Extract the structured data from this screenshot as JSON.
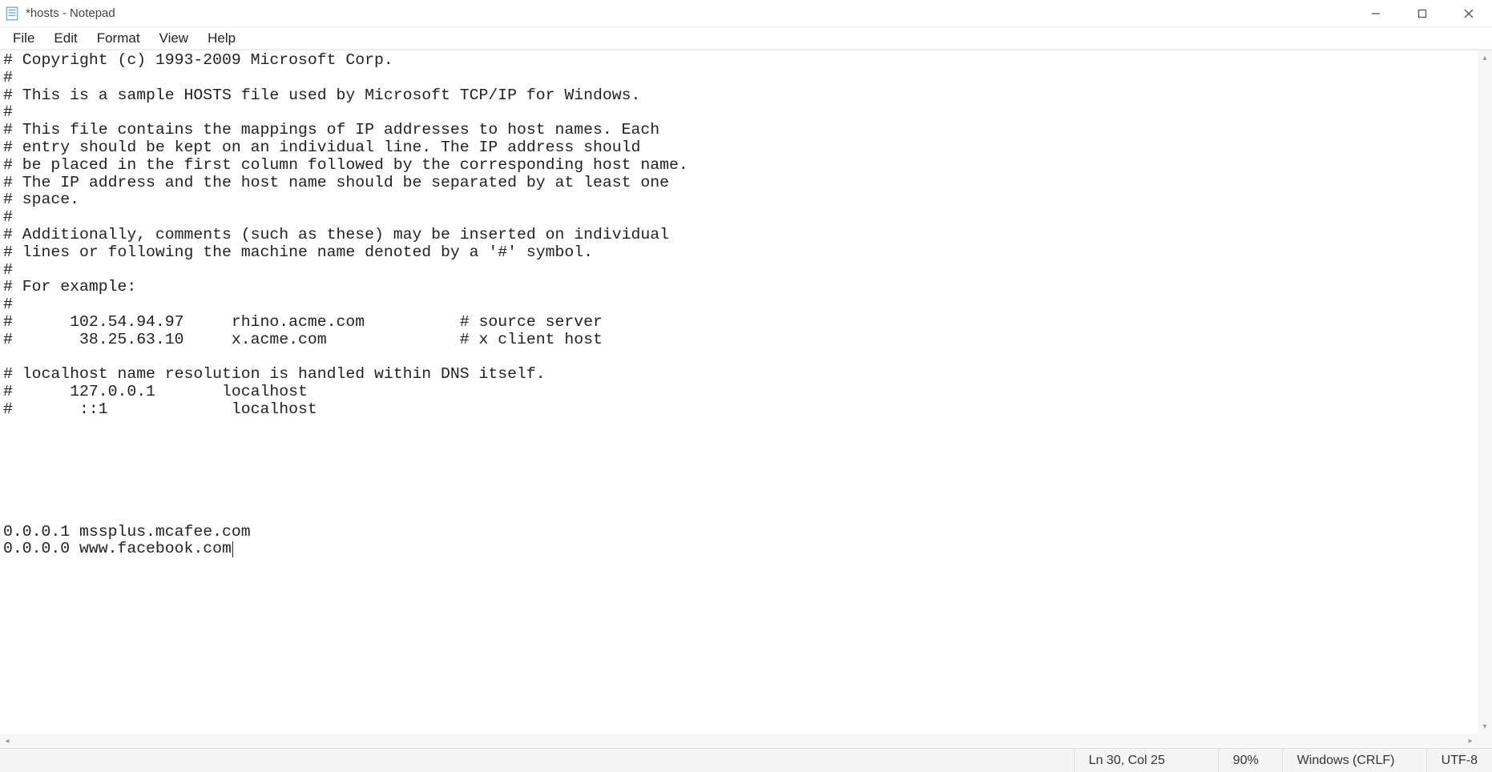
{
  "window": {
    "title": "*hosts - Notepad"
  },
  "menu": {
    "file": "File",
    "edit": "Edit",
    "format": "Format",
    "view": "View",
    "help": "Help"
  },
  "document": {
    "content": "# Copyright (c) 1993-2009 Microsoft Corp.\n#\n# This is a sample HOSTS file used by Microsoft TCP/IP for Windows.\n#\n# This file contains the mappings of IP addresses to host names. Each\n# entry should be kept on an individual line. The IP address should\n# be placed in the first column followed by the corresponding host name.\n# The IP address and the host name should be separated by at least one\n# space.\n#\n# Additionally, comments (such as these) may be inserted on individual\n# lines or following the machine name denoted by a '#' symbol.\n#\n# For example:\n#\n#      102.54.94.97     rhino.acme.com          # source server\n#       38.25.63.10     x.acme.com              # x client host\n\n# localhost name resolution is handled within DNS itself.\n#      127.0.0.1       localhost\n#       ::1             localhost\n\n\n\n\n\n\n0.0.0.1 mssplus.mcafee.com\n0.0.0.0 www.facebook.com"
  },
  "status": {
    "position": "Ln 30, Col 25",
    "zoom": "90%",
    "line_ending": "Windows (CRLF)",
    "encoding": "UTF-8"
  }
}
